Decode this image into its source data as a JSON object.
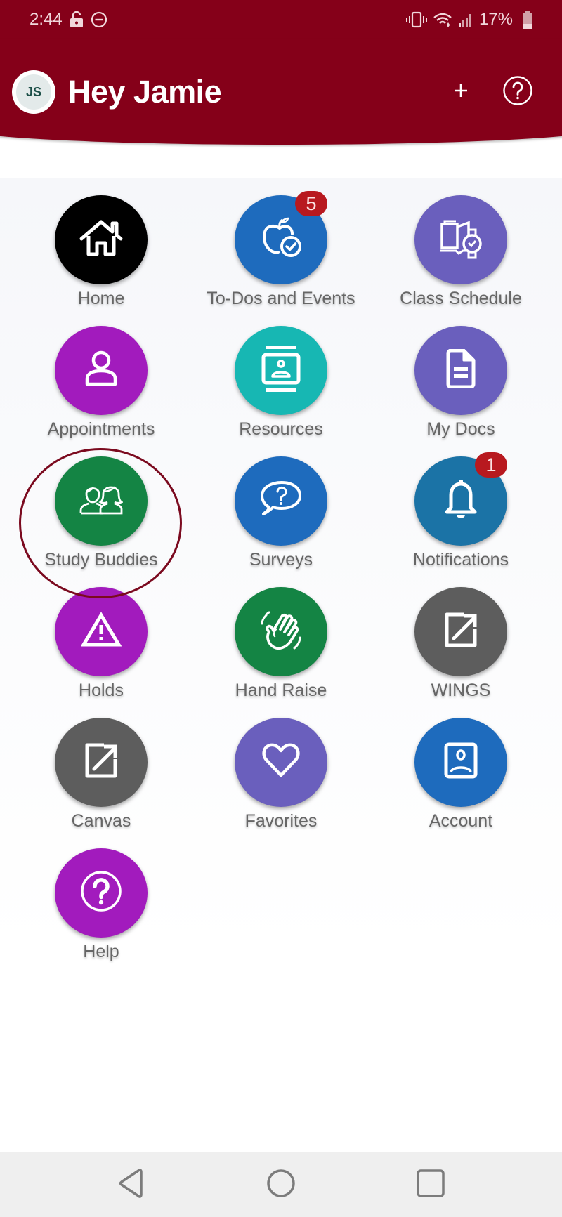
{
  "status_bar": {
    "time": "2:44",
    "battery": "17%",
    "icons": [
      "lock-open-icon",
      "do-not-disturb-icon",
      "vibrate-icon",
      "wifi-icon",
      "signal-icon",
      "battery-icon"
    ]
  },
  "header": {
    "avatar_initials": "JS",
    "greeting": "Hey Jamie",
    "add_icon": "plus-icon",
    "help_icon": "help-circle-icon",
    "background_color": "#850019"
  },
  "tiles": [
    {
      "label": "Home",
      "icon": "home-icon",
      "color": "#000000"
    },
    {
      "label": "To-Dos and Events",
      "icon": "apple-check-icon",
      "color": "#1e6bbd",
      "badge": "5"
    },
    {
      "label": "Class Schedule",
      "icon": "book-watch-icon",
      "color": "#6a5fbd"
    },
    {
      "label": "Appointments",
      "icon": "person-icon",
      "color": "#a21bbd"
    },
    {
      "label": "Resources",
      "icon": "contact-card-icon",
      "color": "#17b7b3"
    },
    {
      "label": "My Docs",
      "icon": "document-icon",
      "color": "#6a5fbd"
    },
    {
      "label": "Study Buddies",
      "icon": "people-icon",
      "color": "#148444"
    },
    {
      "label": "Surveys",
      "icon": "question-bubble-icon",
      "color": "#1e6bbd"
    },
    {
      "label": "Notifications",
      "icon": "bell-icon",
      "color": "#1b73a6",
      "badge": "1"
    },
    {
      "label": "Holds",
      "icon": "warning-icon",
      "color": "#a21bbd"
    },
    {
      "label": "Hand Raise",
      "icon": "hand-wave-icon",
      "color": "#148444"
    },
    {
      "label": "WINGS",
      "icon": "external-link-icon",
      "color": "#5d5d5d"
    },
    {
      "label": "Canvas",
      "icon": "external-link-icon",
      "color": "#5d5d5d"
    },
    {
      "label": "Favorites",
      "icon": "heart-icon",
      "color": "#6a5fbd"
    },
    {
      "label": "Account",
      "icon": "account-box-icon",
      "color": "#1e6bbd"
    },
    {
      "label": "Help",
      "icon": "help-circle-icon",
      "color": "#a21bbd"
    }
  ],
  "highlight": {
    "target": "Study Buddies",
    "color": "#7b0a1f"
  },
  "nav_bar": {
    "buttons": [
      "back-icon",
      "home-circle-icon",
      "recents-icon"
    ]
  }
}
